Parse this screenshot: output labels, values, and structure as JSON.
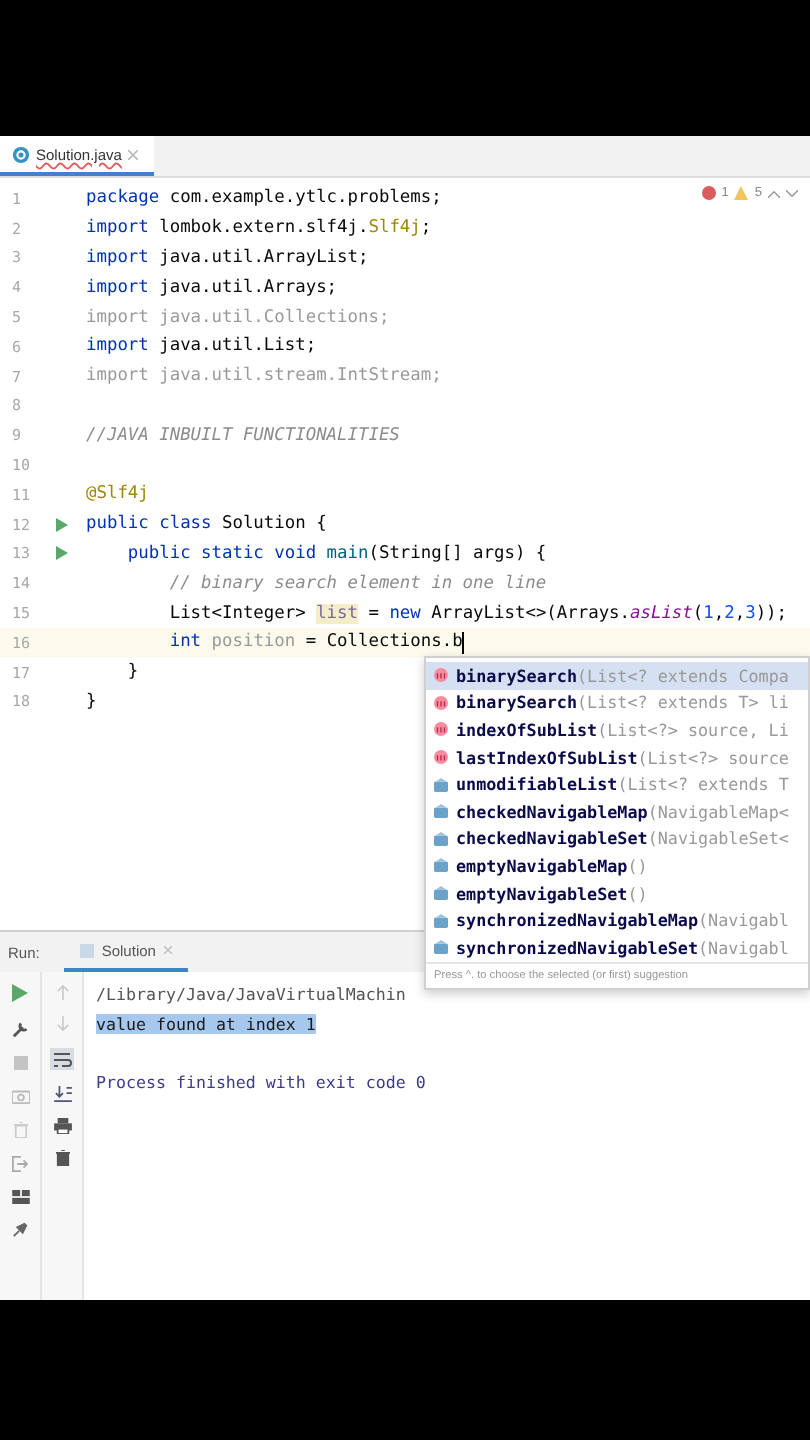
{
  "editor_tab": {
    "label": "Solution.java",
    "selected": true
  },
  "inspections": {
    "errors": "1",
    "warnings": "5"
  },
  "lines": [
    {
      "number": "1",
      "run": false,
      "cursor": false,
      "tokens": [
        {
          "kind": "kw",
          "text": "package"
        },
        {
          "kind": "plain",
          "text": " com.example.ytlc.problems;"
        }
      ]
    },
    {
      "number": "2",
      "run": false,
      "cursor": false,
      "tokens": [
        {
          "kind": "kw",
          "text": "import"
        },
        {
          "kind": "plain",
          "text": " lombok.extern.slf4j."
        },
        {
          "kind": "annotation",
          "text": "Slf4j"
        },
        {
          "kind": "plain",
          "text": ";"
        }
      ]
    },
    {
      "number": "3",
      "run": false,
      "cursor": false,
      "tokens": [
        {
          "kind": "kw",
          "text": "import"
        },
        {
          "kind": "plain",
          "text": " java.util.ArrayList;"
        }
      ]
    },
    {
      "number": "4",
      "run": false,
      "cursor": false,
      "tokens": [
        {
          "kind": "kw",
          "text": "import"
        },
        {
          "kind": "plain",
          "text": " java.util.Arrays;"
        }
      ]
    },
    {
      "number": "5",
      "run": false,
      "cursor": false,
      "tokens": [
        {
          "kind": "unused",
          "text": "import java.util.Collections;"
        }
      ]
    },
    {
      "number": "6",
      "run": false,
      "cursor": false,
      "tokens": [
        {
          "kind": "kw",
          "text": "import"
        },
        {
          "kind": "plain",
          "text": " java.util.List;"
        }
      ]
    },
    {
      "number": "7",
      "run": false,
      "cursor": false,
      "tokens": [
        {
          "kind": "unused",
          "text": "import java.util.stream.IntStream;"
        }
      ]
    },
    {
      "number": "8",
      "run": false,
      "cursor": false
    },
    {
      "number": "9",
      "run": false,
      "cursor": false,
      "tokens": [
        {
          "kind": "comment",
          "text": "//JAVA INBUILT FUNCTIONALITIES"
        }
      ]
    },
    {
      "number": "10",
      "run": false,
      "cursor": false
    },
    {
      "number": "11",
      "run": false,
      "cursor": false,
      "tokens": [
        {
          "kind": "annotation",
          "text": "@Slf4j"
        }
      ]
    },
    {
      "number": "12",
      "run": true,
      "cursor": false,
      "tokens": [
        {
          "kind": "kw",
          "text": "public class"
        },
        {
          "kind": "plain",
          "text": " Solution {"
        }
      ]
    },
    {
      "number": "13",
      "run": true,
      "cursor": false,
      "tokens": [
        {
          "kind": "kw",
          "text": "    public static void"
        },
        {
          "kind": "method",
          "text": " main"
        },
        {
          "kind": "plain",
          "text": "(String[] args) {"
        }
      ]
    },
    {
      "number": "14",
      "run": false,
      "cursor": false,
      "tokens": [
        {
          "kind": "comment",
          "text": "        // binary search element in one line"
        }
      ]
    },
    {
      "number": "15",
      "run": false,
      "cursor": false,
      "tokens": [
        {
          "kind": "plain",
          "text": "        List<Integer> "
        },
        {
          "kind": "warn",
          "text": "list"
        },
        {
          "kind": "plain",
          "text": " = "
        },
        {
          "kind": "kw",
          "text": "new"
        },
        {
          "kind": "plain",
          "text": " ArrayList<>(Arrays."
        },
        {
          "kind": "static",
          "text": "asList"
        },
        {
          "kind": "plain",
          "text": "("
        },
        {
          "kind": "number",
          "text": "1"
        },
        {
          "kind": "plain",
          "text": ","
        },
        {
          "kind": "number",
          "text": "2"
        },
        {
          "kind": "plain",
          "text": ","
        },
        {
          "kind": "number",
          "text": "3"
        },
        {
          "kind": "plain",
          "text": "));"
        }
      ]
    },
    {
      "number": "16",
      "run": false,
      "cursor": true,
      "tokens": [
        {
          "kind": "kw",
          "text": "        int"
        },
        {
          "kind": "unused",
          "text": " position"
        },
        {
          "kind": "plain",
          "text": " = Collections.b"
        }
      ]
    },
    {
      "number": "17",
      "run": false,
      "cursor": false,
      "tokens": [
        {
          "kind": "plain",
          "text": "    }"
        }
      ]
    },
    {
      "number": "18",
      "run": false,
      "cursor": false,
      "tokens": [
        {
          "kind": "plain",
          "text": "}"
        }
      ]
    }
  ],
  "completion": {
    "items": [
      {
        "kind": "method",
        "name": "binarySearch",
        "params": "(List<? extends Compa",
        "selected": true
      },
      {
        "kind": "method",
        "name": "binarySearch",
        "params": "(List<? extends T> li",
        "selected": false
      },
      {
        "kind": "method",
        "name": "indexOfSubList",
        "params": "(List<?> source, Li",
        "selected": false
      },
      {
        "kind": "method",
        "name": "lastIndexOfSubList",
        "params": "(List<?> source",
        "selected": false
      },
      {
        "kind": "static",
        "name": "unmodifiableList",
        "params": "(List<? extends T",
        "selected": false
      },
      {
        "kind": "static",
        "name": "checkedNavigableMap",
        "params": "(NavigableMap<",
        "selected": false
      },
      {
        "kind": "static",
        "name": "checkedNavigableSet",
        "params": "(NavigableSet<",
        "selected": false
      },
      {
        "kind": "static",
        "name": "emptyNavigableMap",
        "params": "()",
        "selected": false
      },
      {
        "kind": "static",
        "name": "emptyNavigableSet",
        "params": "()",
        "selected": false
      },
      {
        "kind": "static",
        "name": "synchronizedNavigableMap",
        "params": "(Navigabl",
        "selected": false
      },
      {
        "kind": "static",
        "name": "synchronizedNavigableSet",
        "params": "(Navigabl",
        "selected": false
      }
    ],
    "hint": "Press ^. to choose the selected (or first) suggestion"
  },
  "run_panel": {
    "label": "Run:",
    "tab": {
      "label": "Solution",
      "selected": true
    },
    "output": [
      {
        "kind": "path",
        "text": "/Library/Java/JavaVirtualMachin",
        "selected": false
      },
      {
        "kind": "stdout",
        "text": "value found at index 1",
        "selected": true
      },
      {
        "kind": "blank"
      },
      {
        "kind": "system",
        "text": "Process finished with exit code 0",
        "selected": false
      }
    ]
  }
}
